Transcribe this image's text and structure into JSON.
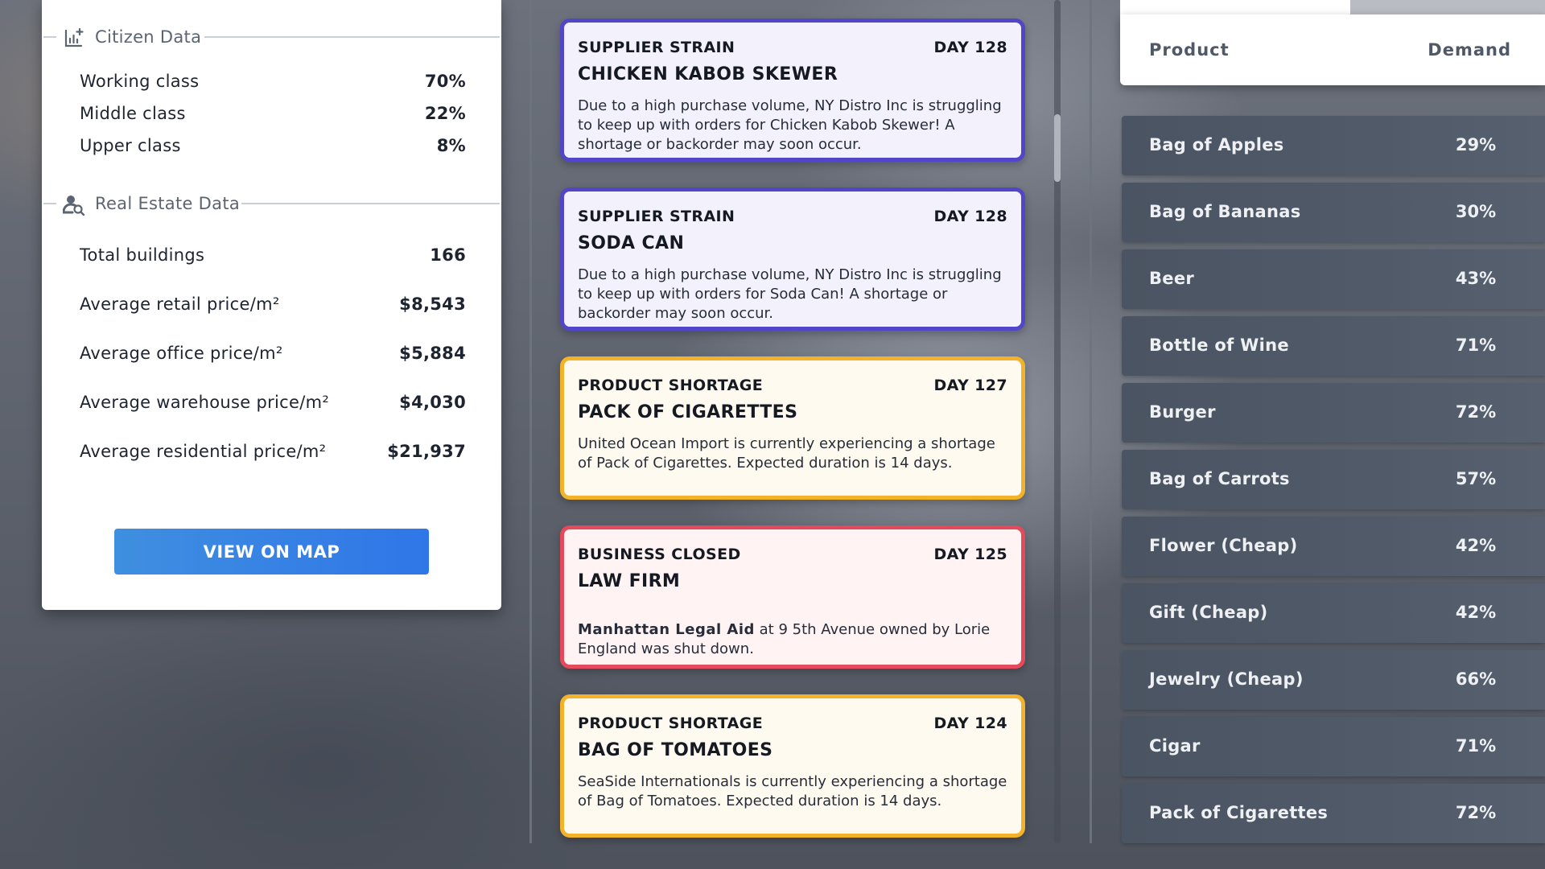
{
  "citizen": {
    "title": "Citizen Data",
    "rows": [
      {
        "label": "Working class",
        "value": "70%"
      },
      {
        "label": "Middle class",
        "value": "22%"
      },
      {
        "label": "Upper class",
        "value": "8%"
      }
    ]
  },
  "real_estate": {
    "title": "Real Estate Data",
    "rows": [
      {
        "label": "Total buildings",
        "value": "166"
      },
      {
        "label": "Average retail price/m²",
        "value": "$8,543"
      },
      {
        "label": "Average office price/m²",
        "value": "$5,884"
      },
      {
        "label": "Average warehouse price/m²",
        "value": "$4,030"
      },
      {
        "label": "Average residential price/m²",
        "value": "$21,937"
      }
    ]
  },
  "map_button_label": "VIEW ON MAP",
  "events": [
    {
      "category": "SUPPLIER STRAIN",
      "day": "DAY 128",
      "title": "CHICKEN KABOB SKEWER",
      "text": "Due to a high purchase volume, NY Distro Inc is struggling to keep up with orders for Chicken Kabob Skewer! A shortage or backorder may soon occur.",
      "color": "#5246c8"
    },
    {
      "category": "SUPPLIER STRAIN",
      "day": "DAY 128",
      "title": "SODA CAN",
      "text": "Due to a high purchase volume, NY Distro Inc is struggling to keep up with orders for Soda Can! A shortage or backorder may soon occur.",
      "color": "#5246c8"
    },
    {
      "category": "PRODUCT SHORTAGE",
      "day": "DAY 127",
      "title": "PACK OF CIGARETTES",
      "text": "United Ocean Import is currently experiencing a shortage of Pack of Cigarettes. Expected duration is 14 days.",
      "color": "#f2b22a"
    },
    {
      "category": "BUSINESS CLOSED",
      "day": "DAY 125",
      "title": "LAW FIRM",
      "text_strong": "Manhattan Legal Aid",
      "text": " at 9 5th Avenue owned by Lorie England was shut down.",
      "color": "#e54a5c"
    },
    {
      "category": "PRODUCT SHORTAGE",
      "day": "DAY 124",
      "title": "BAG OF TOMATOES",
      "text": "SeaSide Internationals is currently experiencing a shortage of Bag of Tomatoes. Expected duration is 14 days.",
      "color": "#f2b22a"
    }
  ],
  "demand_table": {
    "headers": {
      "product": "Product",
      "demand": "Demand"
    },
    "rows": [
      {
        "product": "Bag of Apples",
        "demand": "29%"
      },
      {
        "product": "Bag of Bananas",
        "demand": "30%"
      },
      {
        "product": "Beer",
        "demand": "43%"
      },
      {
        "product": "Bottle of Wine",
        "demand": "71%"
      },
      {
        "product": "Burger",
        "demand": "72%"
      },
      {
        "product": "Bag of Carrots",
        "demand": "57%"
      },
      {
        "product": "Flower (Cheap)",
        "demand": "42%"
      },
      {
        "product": "Gift (Cheap)",
        "demand": "42%"
      },
      {
        "product": "Jewelry (Cheap)",
        "demand": "66%"
      },
      {
        "product": "Cigar",
        "demand": "71%"
      },
      {
        "product": "Pack of Cigarettes",
        "demand": "72%"
      }
    ]
  },
  "icons": {
    "citizen": "chart-plus-icon",
    "real_estate": "user-search-icon"
  }
}
